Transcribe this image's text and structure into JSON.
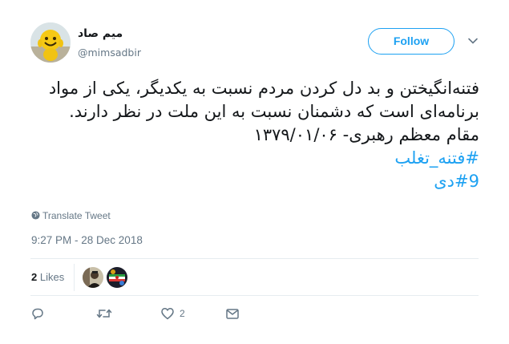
{
  "user": {
    "display_name": "میم صاد",
    "handle": "@mimsadbir",
    "avatar_icon": "smiley-figurine-avatar"
  },
  "follow_label": "Follow",
  "tweet": {
    "lines": [
      "فتنه‌انگیختن و بد دل کردن مردم نسبت به یکدیگر، یکی از مواد",
      "برنامه‌ای است که دشمنان نسبت به این ملت در نظر دارند.",
      "مقام معظم رهبری- ۱۳۷۹/۰۱/۰۶"
    ],
    "hashtags": [
      "#فتنه_تغلب",
      "#9دی"
    ]
  },
  "translate_label": "Translate Tweet",
  "timestamp": "9:27 PM - 28 Dec 2018",
  "likes": {
    "count": "2",
    "label": "Likes"
  },
  "actions": {
    "reply_count": "",
    "retweet_count": "",
    "like_count": "2"
  },
  "colors": {
    "accent": "#1da1f2",
    "muted": "#657786",
    "text": "#14171a",
    "divider": "#e6ecf0"
  }
}
